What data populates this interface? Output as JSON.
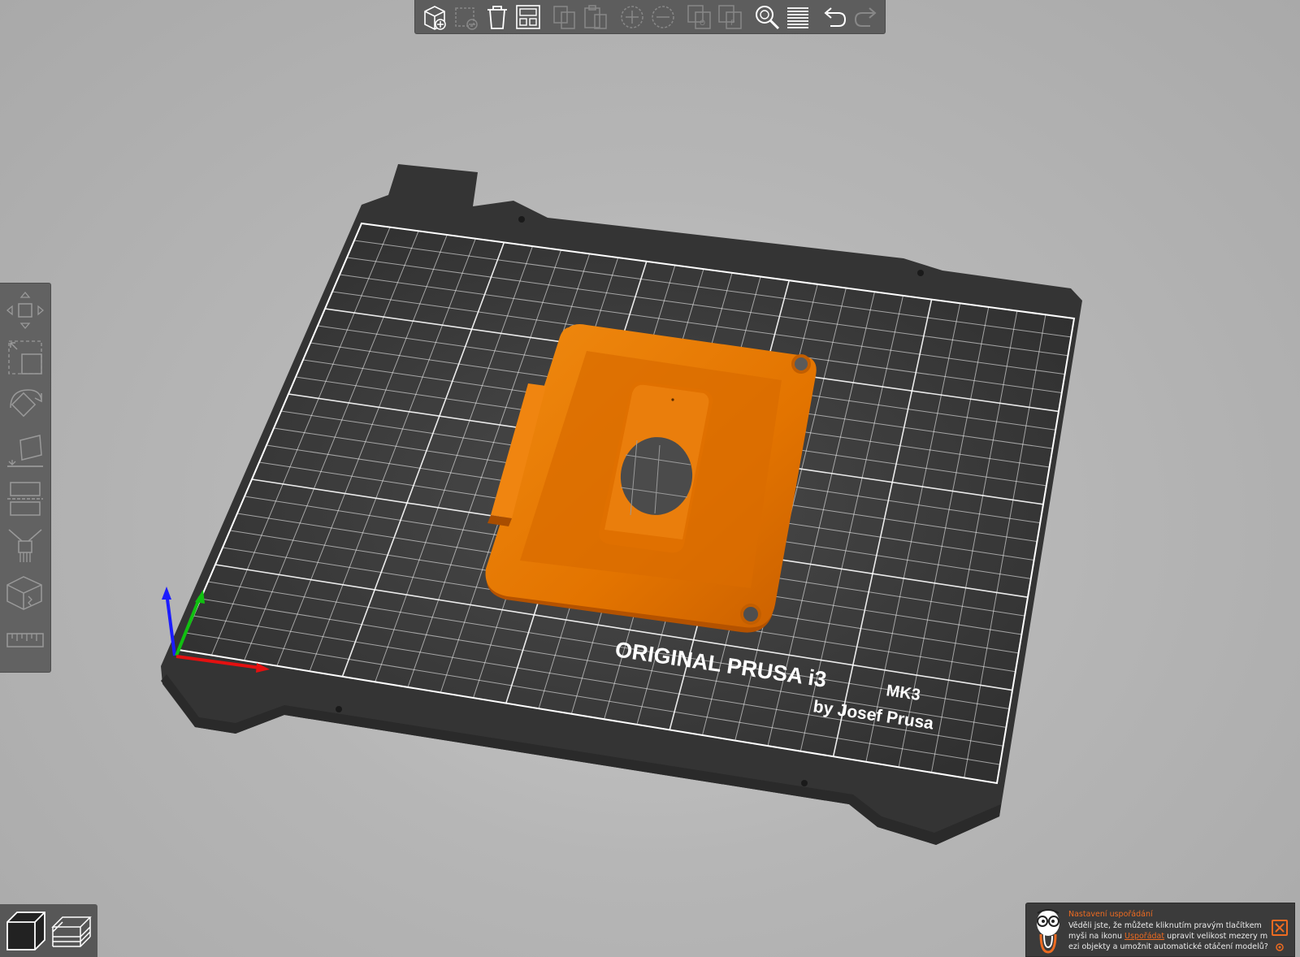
{
  "toolbar": {
    "buttons": [
      {
        "icon": "add-icon",
        "enabled": true
      },
      {
        "icon": "delete-icon",
        "enabled": false
      },
      {
        "icon": "delete-all-icon",
        "enabled": true
      },
      {
        "icon": "arrange-icon",
        "enabled": true
      },
      {
        "icon": "copy-icon",
        "enabled": false
      },
      {
        "icon": "paste-icon",
        "enabled": false
      },
      {
        "icon": "add-instance-icon",
        "enabled": false
      },
      {
        "icon": "remove-instance-icon",
        "enabled": false
      },
      {
        "icon": "split-to-objects-icon",
        "enabled": false
      },
      {
        "icon": "split-to-parts-icon",
        "enabled": false
      },
      {
        "icon": "search-icon",
        "enabled": true
      },
      {
        "icon": "layers-editing-icon",
        "enabled": true
      },
      {
        "icon": "undo-icon",
        "enabled": true
      },
      {
        "icon": "redo-icon",
        "enabled": false
      }
    ]
  },
  "gizmos": [
    "move-icon",
    "scale-icon",
    "rotate-icon",
    "place-on-face-icon",
    "cut-icon",
    "paint-supports-icon",
    "seam-painting-icon",
    "measure-icon"
  ],
  "view_switcher": [
    "3d-view-icon",
    "preview-icon"
  ],
  "bed": {
    "brand_line1": "ORIGINAL PRUSA i3",
    "brand_model": "MK3",
    "brand_line2": "by Josef Prusa",
    "colors": {
      "sheet": "#3c3c3c",
      "grid": "#ffffff",
      "object": "#ec7a00"
    }
  },
  "notification": {
    "title": "Nastavení uspořádání",
    "line1": "Věděli jste, že můžete kliknutím pravým tlačítkem",
    "line2_pre": "myši na ikonu",
    "line2_link": "Uspořádat",
    "line2_post": "upravit velikost mezery m",
    "line3": "ezi objekty a umožnit automatické otáčení modelů?",
    "accent": "#ed6b21"
  }
}
